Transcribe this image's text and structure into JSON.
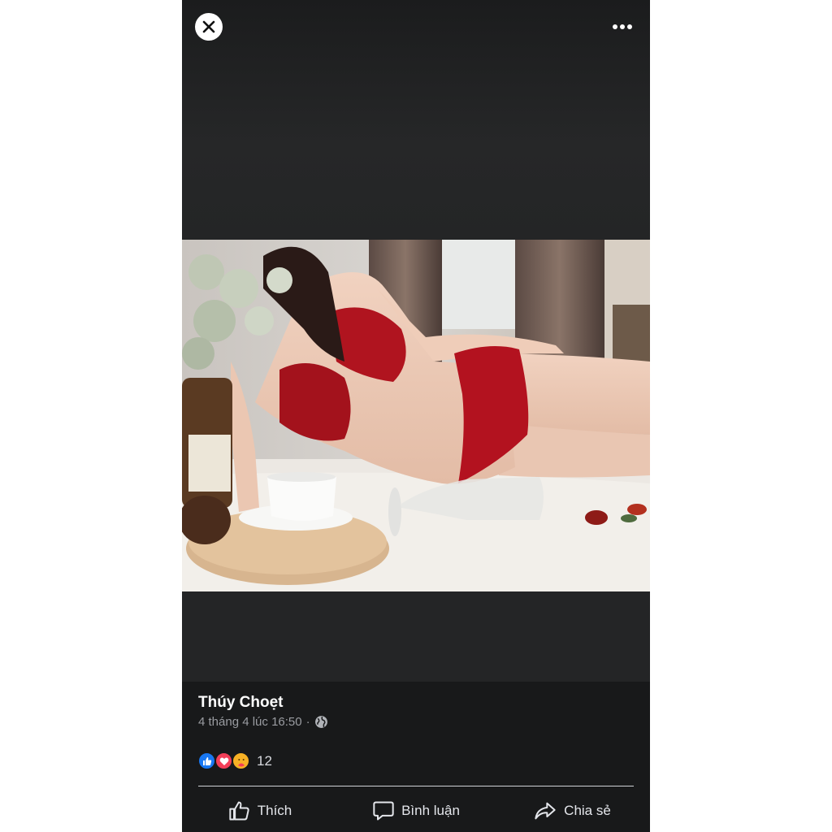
{
  "viewer": {
    "close_icon": "close-icon",
    "more_icon": "more-horizontal-icon"
  },
  "post": {
    "author": "Thúy Choẹt",
    "timestamp": "4 tháng 4 lúc 16:50",
    "separator": "·",
    "privacy_icon": "globe-icon"
  },
  "reactions": {
    "types": [
      "like",
      "love",
      "care"
    ],
    "count": "12"
  },
  "actions": {
    "like_label": "Thích",
    "comment_label": "Bình luận",
    "share_label": "Chia sẻ"
  },
  "colors": {
    "like": "#1877f2",
    "love": "#f33e58",
    "care": "#f7b125",
    "background": "#232425",
    "footer": "#18191a"
  }
}
